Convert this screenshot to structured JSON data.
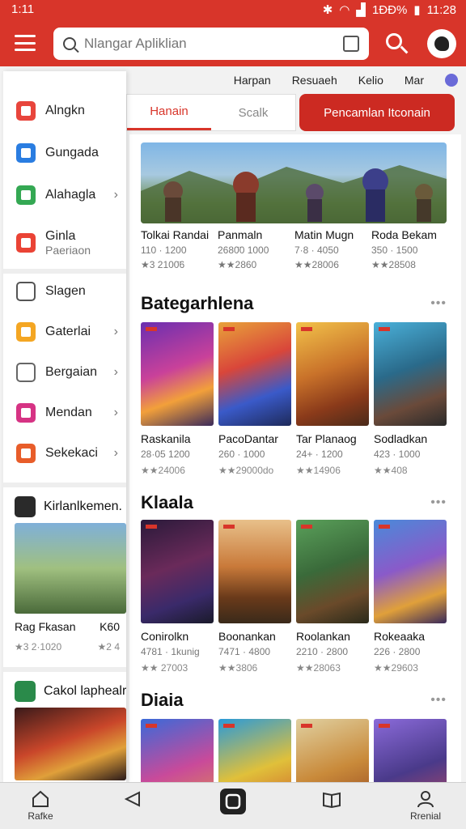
{
  "status": {
    "time": "1:11",
    "battery": "1ĐĐ%",
    "clock": "11:28"
  },
  "header": {
    "search_placeholder": "Nlangar Apliklian"
  },
  "sublinks": [
    "Harpan",
    "Resuaeh",
    "Kelio",
    "Mar"
  ],
  "tabs": [
    "Hanain",
    "Scalk"
  ],
  "promo_button": "Pencamlan Itconain",
  "banner": [
    {
      "name": "Tolkai Randai",
      "meta": "110 · 1200",
      "rating": "★3 2100̈6"
    },
    {
      "name": "Panmaln",
      "meta": "2680̈0 1000",
      "rating": "★★2860"
    },
    {
      "name": "Matin Mugn",
      "meta": "7·8 · 4050",
      "rating": "★★28006"
    },
    {
      "name": "Roda Bekam",
      "meta": "350 · 1500",
      "rating": "★★28508"
    }
  ],
  "sections": [
    {
      "title": "Bategarhlena",
      "items": [
        {
          "name": "Raskanila",
          "meta": "28·05 1200",
          "rating": "★★24006"
        },
        {
          "name": "PacoDantar",
          "meta": "260 · 1000",
          "rating": "★★29000do"
        },
        {
          "name": "Tar Planaog",
          "meta": "24+ · 1200",
          "rating": "★★14906"
        },
        {
          "name": "Sodladkan",
          "meta": "423 · 1000",
          "rating": "★★408"
        }
      ]
    },
    {
      "title": "Klaala",
      "items": [
        {
          "name": "Conirolkn",
          "meta": "4781 · 1kunig",
          "rating": "★★ 27003"
        },
        {
          "name": "Boonankan",
          "meta": "7471 · 4800",
          "rating": "★★3806"
        },
        {
          "name": "Roolankan",
          "meta": "2210 · 2800",
          "rating": "★★28063"
        },
        {
          "name": "Rokeaaka",
          "meta": "226 · 2800",
          "rating": "★★29603"
        }
      ]
    },
    {
      "title": "Diaia",
      "items": []
    }
  ],
  "more_label": "•••",
  "drawer": {
    "items": [
      {
        "label": "Alngkn",
        "color": "#e8453c",
        "chevron": false
      },
      {
        "label": "Gungada",
        "color": "#2a7de1",
        "chevron": false
      },
      {
        "label": "Alahagla",
        "color": "#34a853",
        "chevron": true
      },
      {
        "label": "Ginla",
        "sub": "Paeriaon",
        "color": "#ea4335",
        "chevron": false
      },
      {
        "label": "Slagen",
        "color": "#555555",
        "chevron": false
      },
      {
        "label": "Gaterlai",
        "color": "#f4a623",
        "chevron": true
      },
      {
        "label": "Bergaian",
        "color": "#666666",
        "chevron": true
      },
      {
        "label": "Mendan",
        "color": "#d63384",
        "chevron": true
      },
      {
        "label": "Sekekaci",
        "color": "#e85d2a",
        "chevron": true
      }
    ],
    "games": [
      {
        "title": "Kirlanlkemen.",
        "name": "Rag Fkasan",
        "extra": "K60",
        "rating": "★3 2·1020",
        "rating2": "★2 4"
      },
      {
        "title": "Cakol laphealr",
        "name": "",
        "extra": "",
        "rating": "",
        "rating2": ""
      }
    ]
  },
  "bottom_nav": [
    {
      "label": "Rafke",
      "icon": "home-icon"
    },
    {
      "label": "",
      "icon": "back-icon"
    },
    {
      "label": "",
      "icon": "app-icon"
    },
    {
      "label": "",
      "icon": "book-icon"
    },
    {
      "label": "Rrenial",
      "icon": "profile-icon"
    }
  ]
}
